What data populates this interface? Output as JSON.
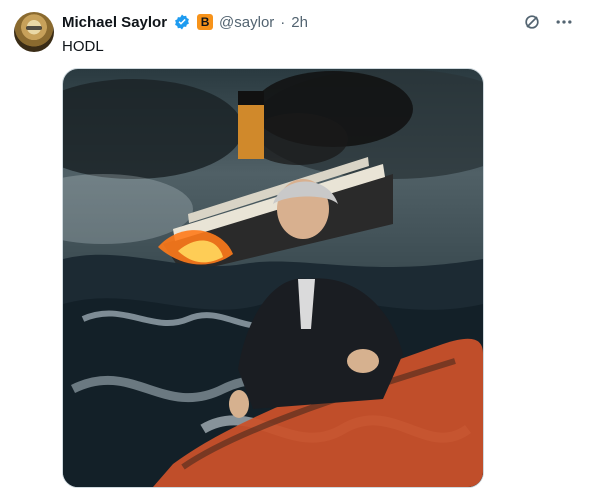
{
  "tweet": {
    "author_name": "Michael Saylor",
    "handle": "@saylor",
    "time": "2h",
    "separator": "·",
    "badge_letter": "B",
    "text": "HODL"
  },
  "icons": {
    "verified": "verified-icon",
    "grok": "grok-icon",
    "more": "more-icon"
  },
  "colors": {
    "verified_blue": "#1d9bf0",
    "badge_orange": "#f7931a",
    "text_dark": "#0f1419",
    "text_secondary": "#536471"
  }
}
